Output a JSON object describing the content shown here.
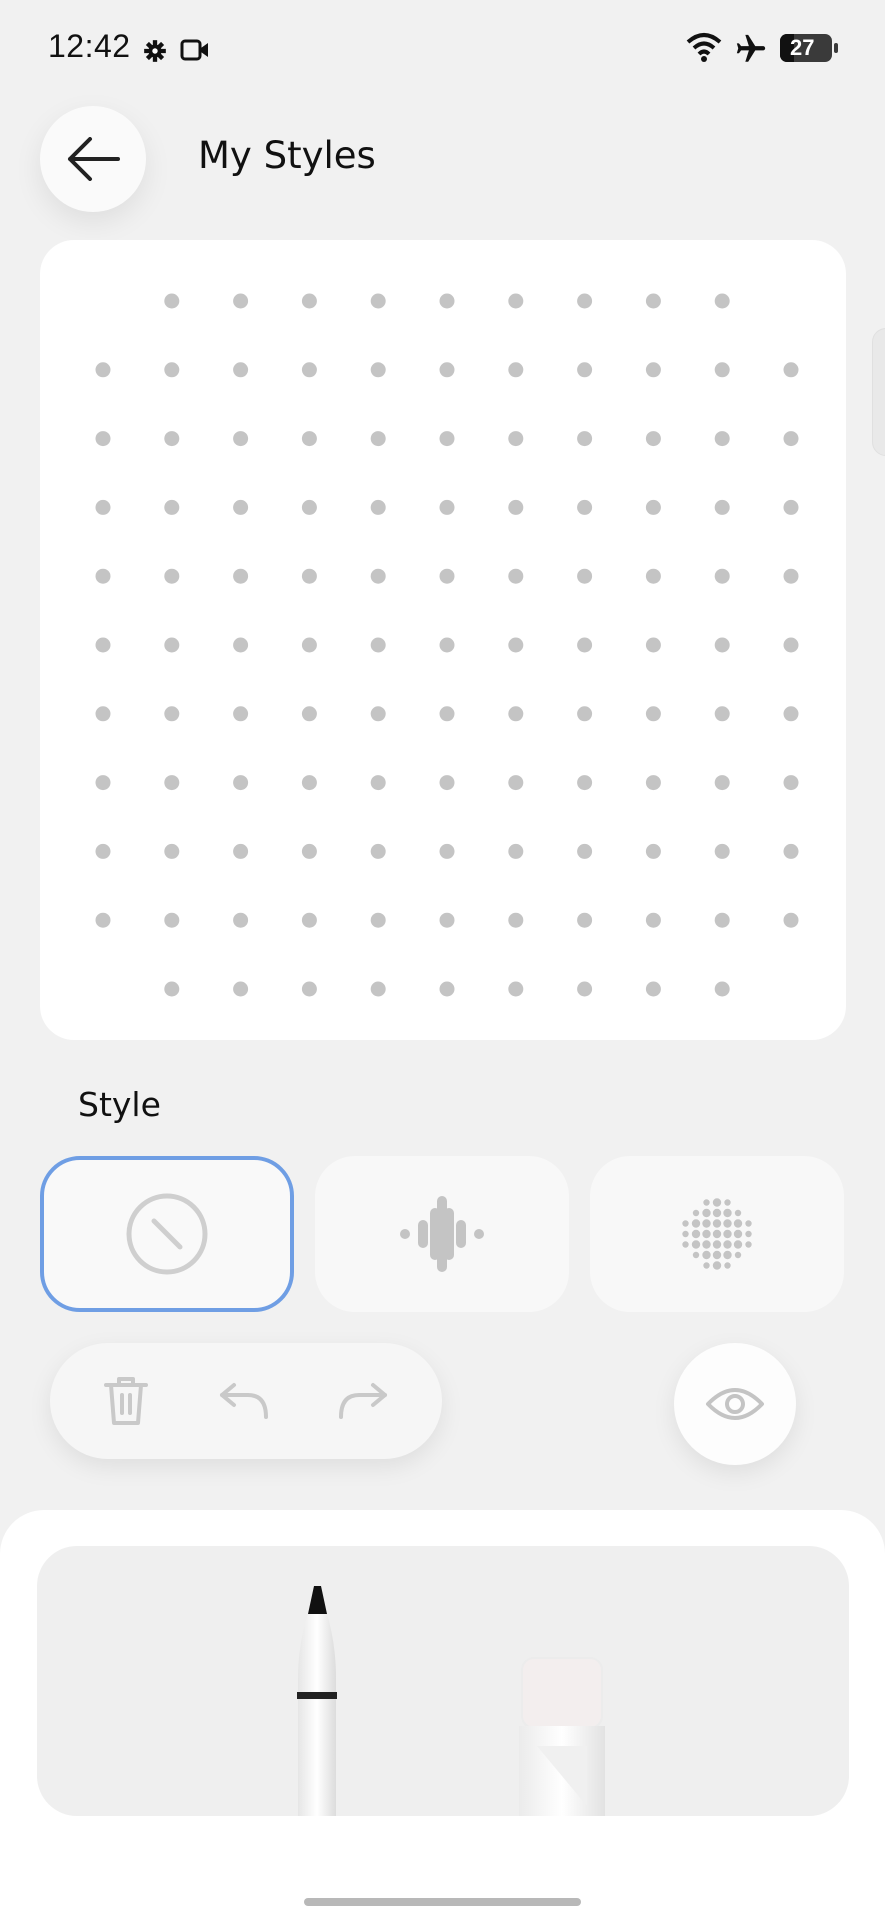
{
  "status_bar": {
    "time": "12:42",
    "battery_level": "27",
    "icons": [
      "settings-gear-icon",
      "video-camera-icon",
      "wifi-icon",
      "airplane-icon",
      "battery-icon"
    ]
  },
  "header": {
    "title": "My Styles",
    "back_icon": "arrow-left-icon"
  },
  "canvas": {
    "rows": 11,
    "columns": 11,
    "corner_cells_empty": true,
    "dot_color": "#c4c4c4"
  },
  "style_section": {
    "label": "Style",
    "options": [
      {
        "icon": "none-slash-icon",
        "selected": true
      },
      {
        "icon": "wave-pattern-icon",
        "selected": false
      },
      {
        "icon": "dot-circle-pattern-icon",
        "selected": false
      }
    ],
    "selected_color": "#6f9ee4"
  },
  "toolbar": {
    "buttons": [
      "trash-icon",
      "undo-icon",
      "redo-icon"
    ],
    "preview_icon": "eye-icon"
  },
  "tools": [
    "pencil-tool",
    "eraser-tool"
  ]
}
